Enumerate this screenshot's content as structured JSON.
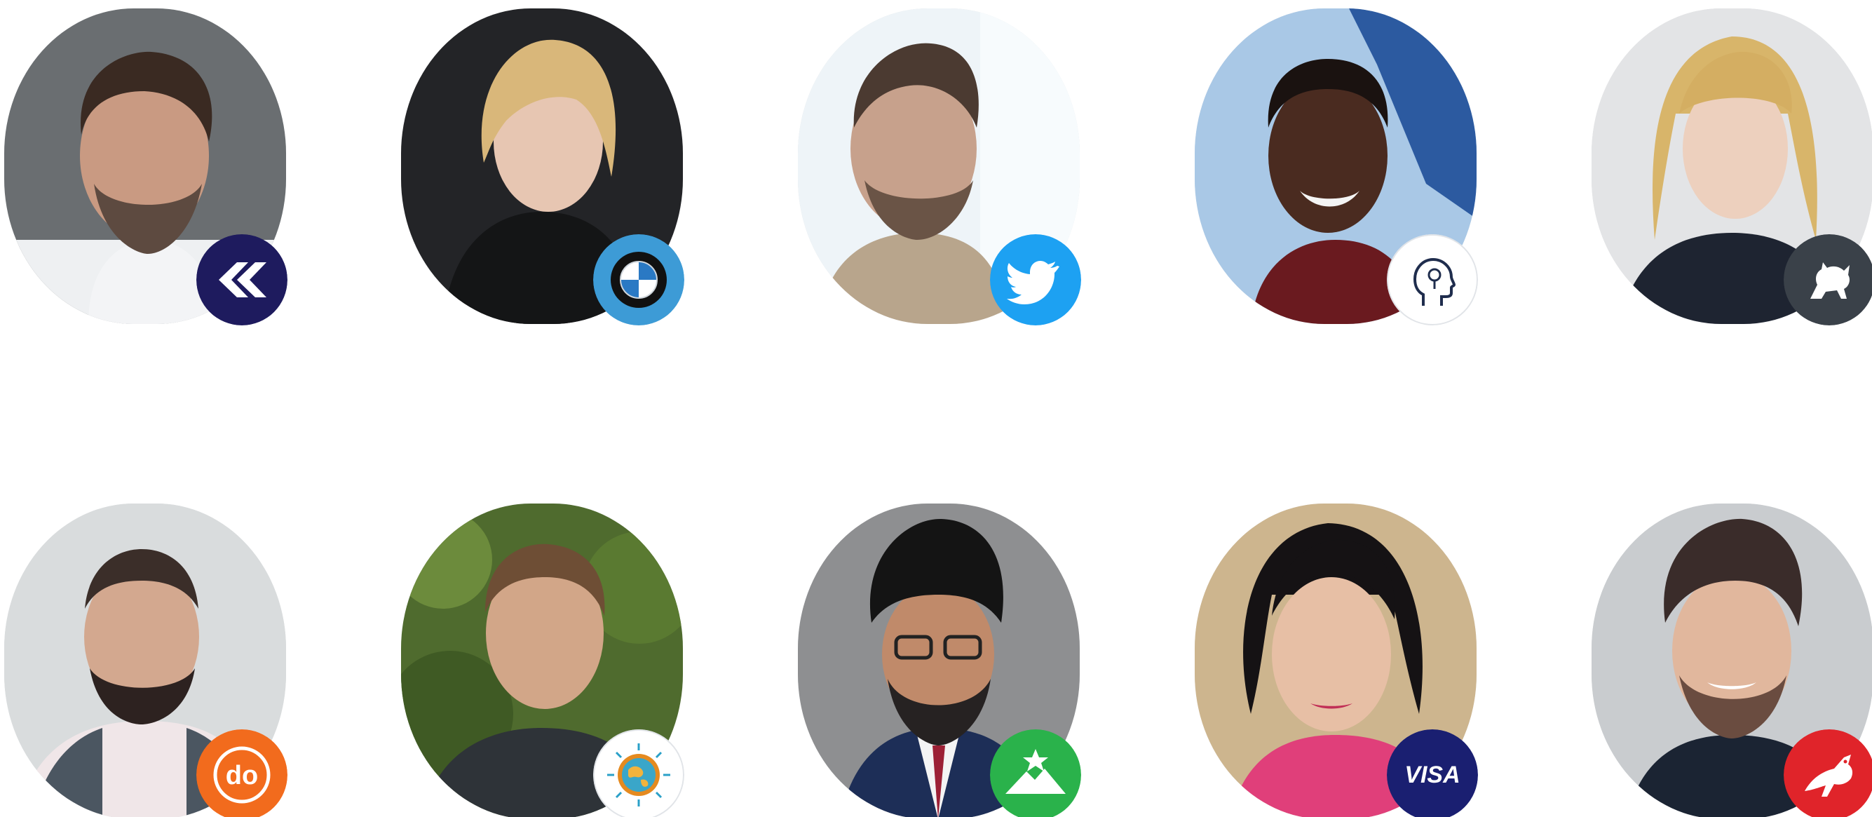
{
  "speakers": [
    {
      "row": 1,
      "col": 1,
      "photo": "man-grey-beard-white-shirt",
      "badge": {
        "icon": "arrow-chevron-logo-icon",
        "bg": "#1e1b5e",
        "fg": "#ffffff"
      }
    },
    {
      "row": 1,
      "col": 2,
      "photo": "woman-blonde-black-jacket",
      "badge": {
        "icon": "bmw-logo-icon",
        "bg": "#3d9bd6",
        "fg": "#ffffff"
      }
    },
    {
      "row": 1,
      "col": 3,
      "photo": "man-selfie-beige-shirt",
      "badge": {
        "icon": "twitter-bird-icon",
        "bg": "#1da1f2",
        "fg": "#ffffff"
      }
    },
    {
      "row": 1,
      "col": 4,
      "photo": "man-smiling-red-shirt",
      "badge": {
        "icon": "head-profile-icon",
        "bg": "#ffffff",
        "fg": "#1f2d4d"
      }
    },
    {
      "row": 1,
      "col": 5,
      "photo": "woman-long-blonde-hair",
      "badge": {
        "icon": "griffin-icon",
        "bg": "#3a4149",
        "fg": "#ffffff"
      }
    },
    {
      "row": 2,
      "col": 1,
      "photo": "man-bald-beard-hoodie",
      "badge": {
        "icon": "do-logo-icon",
        "text": "do",
        "bg": "#f26b1d",
        "fg": "#ffffff"
      }
    },
    {
      "row": 2,
      "col": 2,
      "photo": "man-outdoor-greenery",
      "badge": {
        "icon": "globe-sun-icon",
        "bg": "#ffffff",
        "fg": "#e58a1f"
      }
    },
    {
      "row": 2,
      "col": 3,
      "photo": "man-turban-glasses-suit",
      "badge": {
        "icon": "mountain-star-icon",
        "bg": "#2ab24b",
        "fg": "#ffffff"
      }
    },
    {
      "row": 2,
      "col": 4,
      "photo": "woman-dark-hair-pink-top",
      "badge": {
        "icon": "visa-logo-icon",
        "text": "VISA",
        "bg": "#1a1f71",
        "fg": "#ffffff"
      }
    },
    {
      "row": 2,
      "col": 5,
      "photo": "man-curly-hair-smiling",
      "badge": {
        "icon": "kangaroo-logo-icon",
        "bg": "#e0242a",
        "fg": "#ffffff"
      }
    }
  ],
  "badge_labels": {
    "do": "do",
    "visa": "VISA"
  }
}
